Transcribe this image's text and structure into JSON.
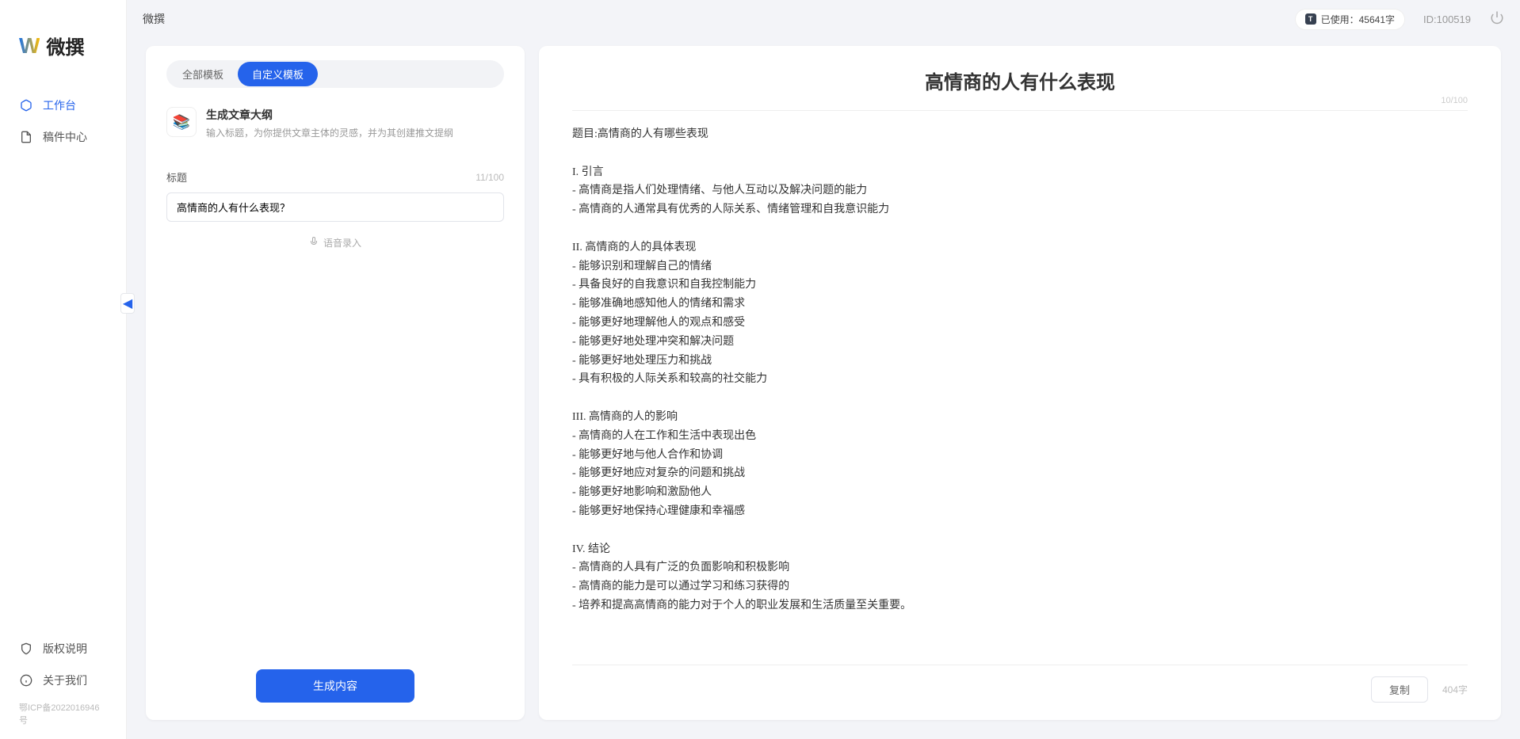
{
  "app": {
    "title": "微撰",
    "logo_text": "微撰"
  },
  "topbar": {
    "usage_label": "已使用：45641字",
    "usage_badge": "T",
    "user_id": "ID:100519"
  },
  "sidebar": {
    "items": [
      {
        "label": "工作台",
        "active": true
      },
      {
        "label": "稿件中心",
        "active": false
      }
    ],
    "bottom": [
      {
        "label": "版权说明"
      },
      {
        "label": "关于我们"
      }
    ],
    "icp": "鄂ICP备2022016946号"
  },
  "left": {
    "tabs": [
      {
        "label": "全部模板",
        "active": false
      },
      {
        "label": "自定义模板",
        "active": true
      }
    ],
    "template": {
      "title": "生成文章大纲",
      "desc": "输入标题，为你提供文章主体的灵感，并为其创建推文提纲"
    },
    "title_field": {
      "label": "标题",
      "count": "11/100",
      "value": "高情商的人有什么表现？"
    },
    "voice_input": "语音录入",
    "generate": "生成内容"
  },
  "right": {
    "title": "高情商的人有什么表现",
    "title_count": "10/100",
    "body": "题目:高情商的人有哪些表现\n\nI. 引言\n- 高情商是指人们处理情绪、与他人互动以及解决问题的能力\n- 高情商的人通常具有优秀的人际关系、情绪管理和自我意识能力\n\nII. 高情商的人的具体表现\n- 能够识别和理解自己的情绪\n- 具备良好的自我意识和自我控制能力\n- 能够准确地感知他人的情绪和需求\n- 能够更好地理解他人的观点和感受\n- 能够更好地处理冲突和解决问题\n- 能够更好地处理压力和挑战\n- 具有积极的人际关系和较高的社交能力\n\nIII. 高情商的人的影响\n- 高情商的人在工作和生活中表现出色\n- 能够更好地与他人合作和协调\n- 能够更好地应对复杂的问题和挑战\n- 能够更好地影响和激励他人\n- 能够更好地保持心理健康和幸福感\n\nIV. 结论\n- 高情商的人具有广泛的负面影响和积极影响\n- 高情商的能力是可以通过学习和练习获得的\n- 培养和提高高情商的能力对于个人的职业发展和生活质量至关重要。",
    "copy": "复制",
    "word_count": "404字"
  }
}
